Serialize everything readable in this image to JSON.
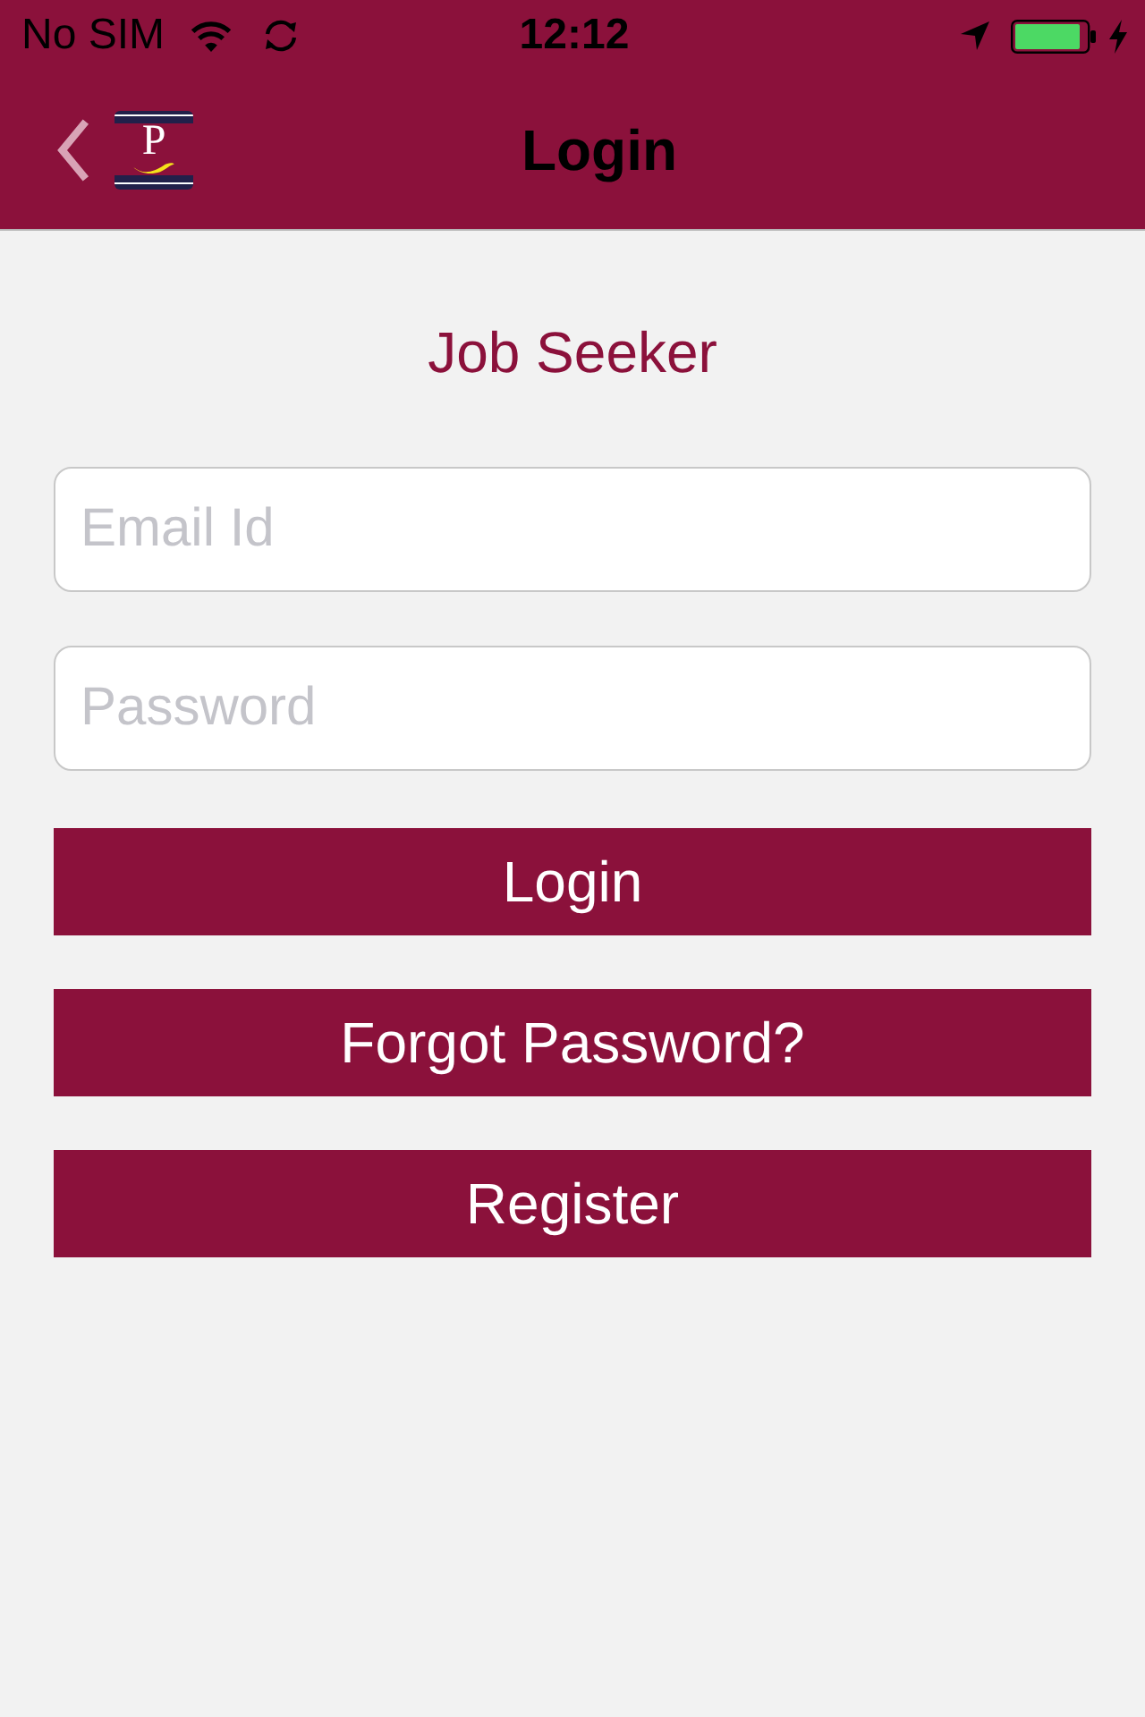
{
  "status_bar": {
    "carrier": "No SIM",
    "time": "12:12"
  },
  "nav_bar": {
    "logo_letter": "P",
    "title": "Login"
  },
  "form": {
    "heading": "Job Seeker",
    "fields": [
      {
        "placeholder": "Email Id"
      },
      {
        "placeholder": "Password"
      }
    ],
    "buttons": [
      "Login",
      "Forgot Password?",
      "Register"
    ]
  }
}
